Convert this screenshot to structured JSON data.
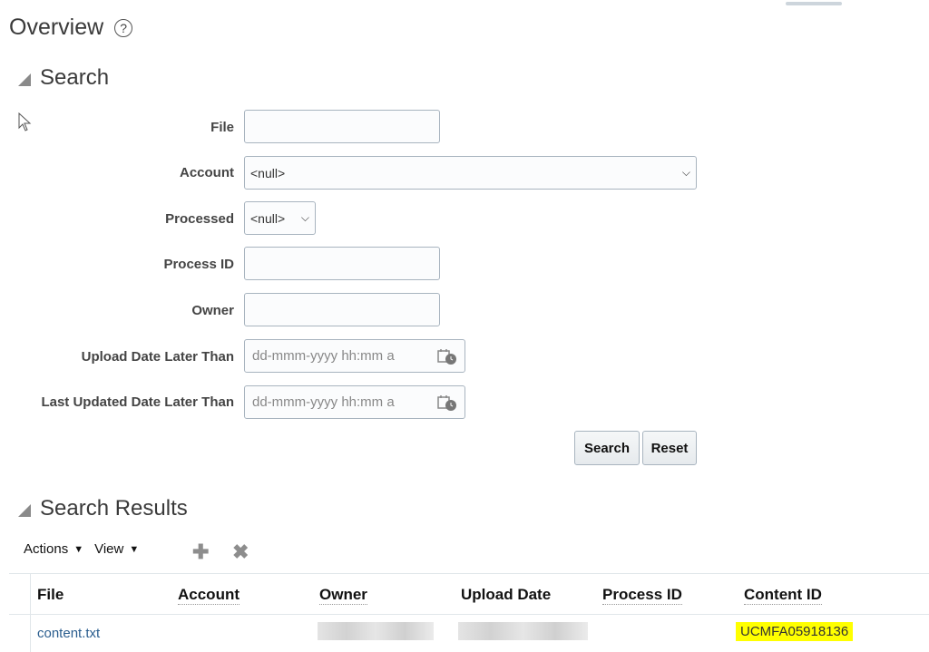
{
  "page": {
    "title": "Overview",
    "help_icon": "help-circle-icon"
  },
  "search_section": {
    "title": "Search",
    "fields": {
      "file": {
        "label": "File",
        "value": ""
      },
      "account": {
        "label": "Account",
        "value": "<null>"
      },
      "processed": {
        "label": "Processed",
        "value": "<null>"
      },
      "process_id": {
        "label": "Process ID",
        "value": ""
      },
      "owner": {
        "label": "Owner",
        "value": ""
      },
      "upload_date": {
        "label": "Upload Date Later Than",
        "placeholder": "dd-mmm-yyyy hh:mm a"
      },
      "last_updated": {
        "label": "Last Updated Date Later Than",
        "placeholder": "dd-mmm-yyyy hh:mm a"
      }
    },
    "buttons": {
      "search": "Search",
      "reset": "Reset"
    }
  },
  "results_section": {
    "title": "Search Results",
    "toolbar": {
      "actions": "Actions",
      "view": "View",
      "add_icon": "plus-icon",
      "delete_icon": "x-icon"
    },
    "columns": [
      "File",
      "Account",
      "Owner",
      "Upload Date",
      "Process ID",
      "Content ID"
    ],
    "rows": [
      {
        "file": "content.txt",
        "account": "",
        "owner": "[redacted]",
        "upload_date": "[redacted]",
        "process_id": "",
        "content_id": "UCMFA05918136"
      }
    ],
    "highlight_color": "#ffff00"
  }
}
